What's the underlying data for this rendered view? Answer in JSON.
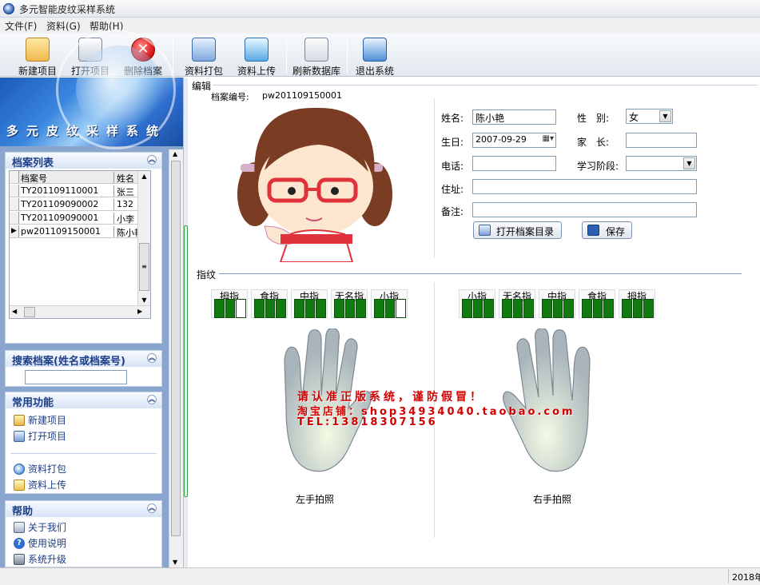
{
  "window": {
    "title": "多元智能皮纹采样系统"
  },
  "menubar": [
    "文件(F)",
    "资料(G)",
    "帮助(H)"
  ],
  "toolbar": [
    {
      "label": "新建项目",
      "icon": "new-project-icon"
    },
    {
      "label": "打开项目",
      "icon": "open-project-icon"
    },
    {
      "label": "删除档案",
      "icon": "delete-record-icon"
    },
    {
      "label": "资料打包",
      "icon": "package-data-icon"
    },
    {
      "label": "资料上传",
      "icon": "upload-data-icon"
    },
    {
      "label": "刷新数据库",
      "icon": "refresh-database-icon"
    },
    {
      "label": "退出系统",
      "icon": "exit-system-icon"
    }
  ],
  "banner": {
    "text": "多元皮纹采样系统"
  },
  "record_list": {
    "title": "档案列表",
    "columns": [
      "档案号",
      "姓名"
    ],
    "rows": [
      {
        "id": "TY201109110001",
        "name": "张三"
      },
      {
        "id": "TY201109090002",
        "name": "132"
      },
      {
        "id": "TY201109090001",
        "name": "小李"
      },
      {
        "id": "pw201109150001",
        "name": "陈小艳"
      }
    ]
  },
  "search": {
    "title": "搜索档案(姓名或档案号)",
    "value": ""
  },
  "common": {
    "title": "常用功能",
    "items": [
      "新建项目",
      "打开项目",
      "资料打包",
      "资料上传"
    ]
  },
  "help": {
    "title": "帮助",
    "items": [
      "关于我们",
      "使用说明",
      "系统升级"
    ]
  },
  "edit": {
    "section": "编辑",
    "record_no_label": "档案编号:",
    "record_no": "pw201109150001",
    "name_label": "姓名:",
    "name": "陈小艳",
    "gender_label": "性　别:",
    "gender": "女",
    "birthday_label": "生日:",
    "birthday": "2007-09-29",
    "parent_label": "家　长:",
    "parent": "",
    "phone_label": "电话:",
    "phone": "",
    "stage_label": "学习阶段:",
    "stage": "",
    "address_label": "住址:",
    "address": "",
    "note_label": "备注:",
    "note": "",
    "open_dir_button": "打开档案目录",
    "save_button": "保存"
  },
  "fingerprint": {
    "section": "指纹",
    "left_fingers": [
      "拇指",
      "食指",
      "中指",
      "无名指",
      "小指"
    ],
    "right_fingers": [
      "小指",
      "无名指",
      "中指",
      "食指",
      "拇指"
    ],
    "left_caption": "左手拍照",
    "right_caption": "右手拍照"
  },
  "warning": {
    "line1": "请认准正版系统，谨防假冒！",
    "line2": "淘宝店铺：shop34934040.taobao.com",
    "line3": "TEL:13818307156"
  },
  "status": {
    "text": "2018年"
  },
  "colors": {
    "accent": "#1d3e86",
    "finger_fill": "#117a11",
    "warning": "#d20000"
  }
}
